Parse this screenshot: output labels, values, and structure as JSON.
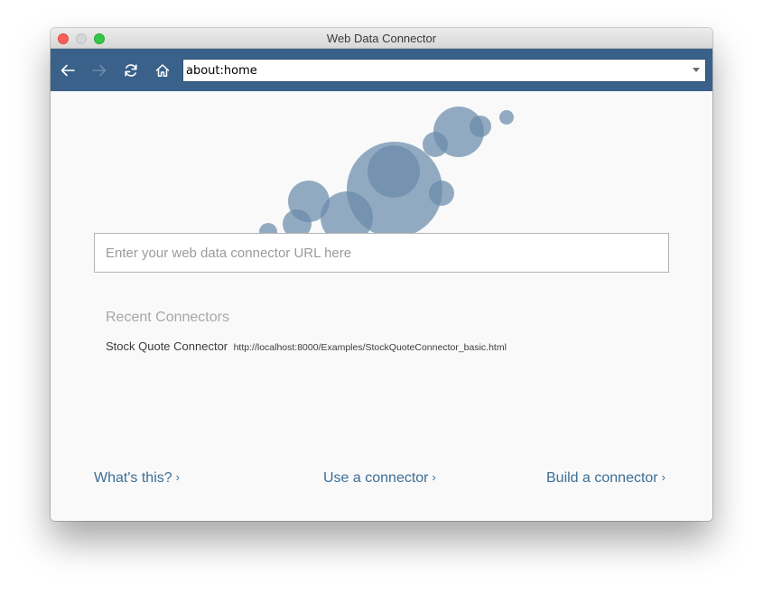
{
  "window": {
    "title": "Web Data Connector"
  },
  "toolbar": {
    "back_icon": "arrow-left-icon",
    "forward_icon": "arrow-right-icon",
    "reload_icon": "reload-icon",
    "home_icon": "home-icon",
    "url_value": "about:home",
    "accent_color": "#3a6189"
  },
  "main": {
    "search_placeholder": "Enter your web data connector URL here",
    "recent_heading": "Recent Connectors",
    "recent_items": [
      {
        "name": "Stock Quote Connector",
        "url": "http://localhost:8000/Examples/StockQuoteConnector_basic.html"
      }
    ],
    "bubble_color": "#6a8bab"
  },
  "footer": {
    "whats_this": "What's this?",
    "use_connector": "Use a connector",
    "build_connector": "Build a connector",
    "chevron": "›",
    "link_color": "#3d6e95"
  }
}
